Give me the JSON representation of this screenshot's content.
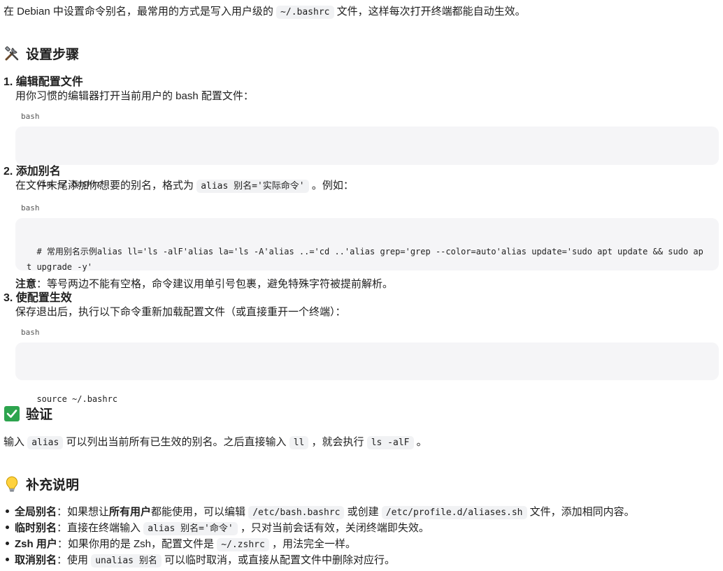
{
  "intro": {
    "t1": "在 Debian 中设置命令别名，最常用的方式是写入用户级的",
    "code": "~/.bashrc",
    "t2": "文件，这样每次打开终端都能自动生效。"
  },
  "section_setup": {
    "title": "设置步骤",
    "icon": "tools-icon"
  },
  "step1": {
    "num": "1.",
    "title": "编辑配置文件",
    "desc": "用你习惯的编辑器打开当前用户的 bash 配置文件：",
    "lang": "bash",
    "code": "vim ~/.bashrc"
  },
  "step2": {
    "num": "2.",
    "title": "添加别名",
    "desc_a": "在文件末尾添加你想要的别名，格式为",
    "desc_code": "alias 别名='实际命令'",
    "desc_b": "。例如：",
    "lang": "bash",
    "code": "# 常用别名示例alias ll='ls -alF'alias la='ls -A'alias ..='cd ..'alias grep='grep --color=auto'alias update='sudo apt update && sudo apt upgrade -y'",
    "note_label": "注意",
    "note_text": "：等号两边不能有空格，命令建议用单引号包裹，避免特殊字符被提前解析。"
  },
  "step3": {
    "num": "3.",
    "title": "使配置生效",
    "desc": "保存退出后，执行以下命令重新加载配置文件（或直接重开一个终端）：",
    "lang": "bash",
    "code": "source ~/.bashrc"
  },
  "section_verify": {
    "title": "验证",
    "icon": "check-icon"
  },
  "verify": {
    "t1": "输入",
    "c1": "alias",
    "t2": "可以列出当前所有已生效的别名。之后直接输入",
    "c2": "ll",
    "t3": "，就会执行",
    "c3": "ls -alF",
    "t4": "。"
  },
  "section_extra": {
    "title": "补充说明",
    "icon": "lightbulb-icon"
  },
  "extras": {
    "b1_label": "全局别名",
    "b1_t1": "：如果想让",
    "b1_bold": "所有用户",
    "b1_t2": "都能使用，可以编辑",
    "b1_c1": "/etc/bash.bashrc",
    "b1_t3": "或创建",
    "b1_c2": "/etc/profile.d/aliases.sh",
    "b1_t4": "文件，添加相同内容。",
    "b2_label": "临时别名",
    "b2_t1": "：直接在终端输入",
    "b2_c1": "alias 别名='命令'",
    "b2_t2": "，只对当前会话有效，关闭终端即失效。",
    "b3_label": "Zsh 用户",
    "b3_t1": "：如果你用的是 Zsh，配置文件是",
    "b3_c1": "~/.zshrc",
    "b3_t2": "，用法完全一样。",
    "b4_label": "取消别名",
    "b4_t1": "：使用",
    "b4_c1": "unalias 别名",
    "b4_t2": "可以临时取消，或直接从配置文件中删除对应行。"
  }
}
